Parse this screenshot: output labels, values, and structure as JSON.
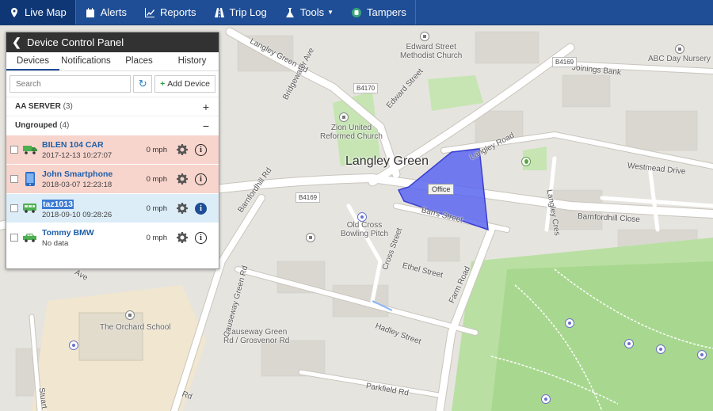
{
  "nav": {
    "items": [
      {
        "label": "Live Map",
        "icon": "map-pin-icon"
      },
      {
        "label": "Alerts",
        "icon": "calendar-icon"
      },
      {
        "label": "Reports",
        "icon": "chart-icon"
      },
      {
        "label": "Trip Log",
        "icon": "road-icon"
      },
      {
        "label": "Tools",
        "icon": "flask-icon"
      },
      {
        "label": "Tampers",
        "icon": "tamper-icon"
      }
    ],
    "active": "Live Map",
    "colors": {
      "bar": "#1f4e96",
      "active": "#0f3775"
    }
  },
  "panel": {
    "title": "Device Control Panel",
    "tabs": [
      "Devices",
      "Notifications",
      "Places",
      "History"
    ],
    "active_tab": "Devices",
    "search_placeholder": "Search",
    "add_device_label": "Add Device",
    "groups": [
      {
        "name": "AA SERVER",
        "count": "(3)",
        "toggle": "+"
      },
      {
        "name": "Ungrouped",
        "count": "(4)",
        "toggle": "−"
      }
    ],
    "devices": [
      {
        "name": "BILEN 104 CAR",
        "time": "2017-12-13 10:27:07",
        "speed": "0 mph",
        "icon": "truck-icon",
        "row_color": "#f7d4cc"
      },
      {
        "name": "John Smartphone",
        "time": "2018-03-07 12:23:18",
        "speed": "0 mph",
        "icon": "smartphone-icon",
        "row_color": "#f7d4cc"
      },
      {
        "name": "taz1013",
        "time": "2018-09-10 09:28:26",
        "speed": "0 mph",
        "icon": "bus-icon",
        "row_color": "#dcedf8"
      },
      {
        "name": "Tommy BMW",
        "time": "No data",
        "speed": "0 mph",
        "icon": "car-icon",
        "row_color": "#ffffff"
      }
    ]
  },
  "map": {
    "place_labels": {
      "langley_green": "Langley Green",
      "office": "Office",
      "edward_church": "Edward Street\nMethodist Church",
      "zion": "Zion United\nReformed Church",
      "abc_nursery": "ABC Day Nursery",
      "old_cross": "Old Cross\nBowling Pitch",
      "orchard_school": "The Orchard School",
      "causeway_stop": "Causeway Green\nRd / Grosvenor Rd"
    },
    "road_labels": {
      "langley_green_rd": "Langley Green Rd",
      "bridgewater": "Bridgewater Ave",
      "edward_st": "Edward Street",
      "joinings_bank": "Joinings Bank",
      "langley_road": "Langley Road",
      "westmead": "Westmead Drive",
      "langley_cres": "Langley Cres",
      "barnfordhill_close": "Barnfordhill Close",
      "barnfordhill_rd": "Barnfordhill Rd",
      "barrs": "Barrs Street",
      "cross_street": "Cross Street",
      "ethel": "Ethel Street",
      "farm_road": "Farm Road",
      "causeway_green": "Causeway Green Rd",
      "hadley": "Hadley Street",
      "stuart": "Stuart Lane",
      "parkfield": "Parkfield Rd",
      "rd_fragment": "Rd",
      "ave_fragment": "Ave"
    },
    "shields": [
      "B4170",
      "B4169",
      "B4169"
    ],
    "geofence_color": "#5b66f0"
  }
}
